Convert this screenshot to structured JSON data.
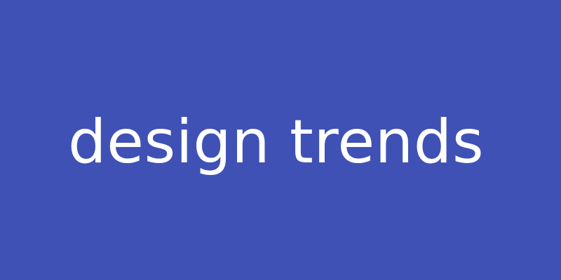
{
  "banner": {
    "headline": "design trends",
    "background_color": "#3f51b5",
    "text_color": "#ffffff"
  }
}
